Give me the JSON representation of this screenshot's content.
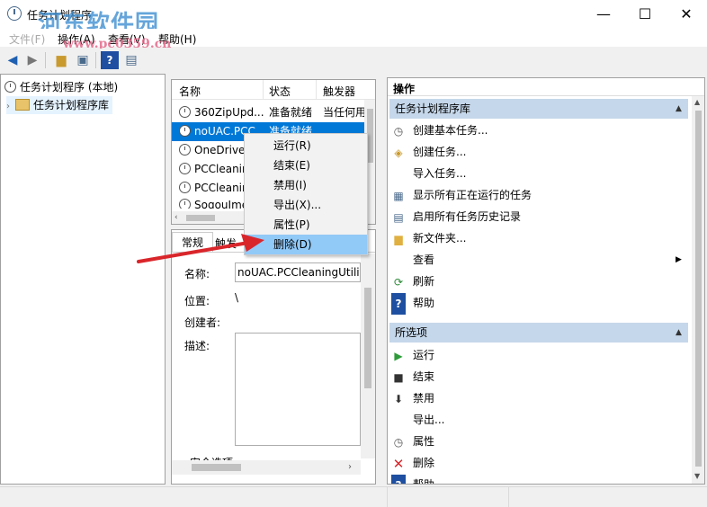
{
  "window": {
    "title": "任务计划程序",
    "minimize": "—",
    "maximize": "☐",
    "close": "✕"
  },
  "watermark": {
    "text": "河东软件园",
    "url": "www.pc0359.cn"
  },
  "menu": [
    "文件(F)",
    "操作(A)",
    "查看(V)",
    "帮助(H)"
  ],
  "tree": {
    "root": "任务计划程序 (本地)",
    "child": "任务计划程序库"
  },
  "task_list": {
    "columns": [
      "名称",
      "状态",
      "触发器"
    ],
    "rows": [
      {
        "name": "360ZipUpd...",
        "status": "准备就绪",
        "trigger": "当任何用户..."
      },
      {
        "name": "noUAC.PCC...",
        "status": "准备就绪",
        "trigger": ""
      },
      {
        "name": "OneDrive ...",
        "status": "",
        "trigger": ""
      },
      {
        "name": "PCCleanin...",
        "status": "",
        "trigger": ""
      },
      {
        "name": "PCCleanin...",
        "status": "",
        "trigger": ""
      },
      {
        "name": "SogouIme...",
        "status": "",
        "trigger": ""
      }
    ]
  },
  "context_menu": [
    "运行(R)",
    "结束(E)",
    "禁用(I)",
    "导出(X)...",
    "属性(P)",
    "删除(D)"
  ],
  "details": {
    "tabs": [
      "常规",
      "触发"
    ],
    "name_label": "名称:",
    "name_value": "noUAC.PCCleaningUtility",
    "location_label": "位置:",
    "location_value": "\\",
    "author_label": "创建者:",
    "desc_label": "描述:",
    "security_label": "安全选项"
  },
  "actions": {
    "title": "操作",
    "library_section": "任务计划程序库",
    "library_items": [
      {
        "label": "创建基本任务...",
        "icon": "basic-task-icon"
      },
      {
        "label": "创建任务...",
        "icon": "create-task-icon"
      },
      {
        "label": "导入任务...",
        "icon": ""
      },
      {
        "label": "显示所有正在运行的任务",
        "icon": "running-tasks-icon"
      },
      {
        "label": "启用所有任务历史记录",
        "icon": "history-icon"
      },
      {
        "label": "新文件夹...",
        "icon": "folder-icon"
      },
      {
        "label": "查看",
        "icon": ""
      },
      {
        "label": "刷新",
        "icon": "refresh-icon"
      },
      {
        "label": "帮助",
        "icon": "help-icon"
      }
    ],
    "selected_section": "所选项",
    "selected_items": [
      {
        "label": "运行",
        "icon": "run-icon"
      },
      {
        "label": "结束",
        "icon": "stop-icon"
      },
      {
        "label": "禁用",
        "icon": "disable-icon"
      },
      {
        "label": "导出...",
        "icon": ""
      },
      {
        "label": "属性",
        "icon": "properties-icon"
      },
      {
        "label": "删除",
        "icon": "delete-icon"
      },
      {
        "label": "帮助",
        "icon": "help-icon"
      }
    ]
  },
  "colors": {
    "selection": "#0078d7",
    "section_header": "#c5d7ea",
    "arrow": "#d9262b"
  }
}
